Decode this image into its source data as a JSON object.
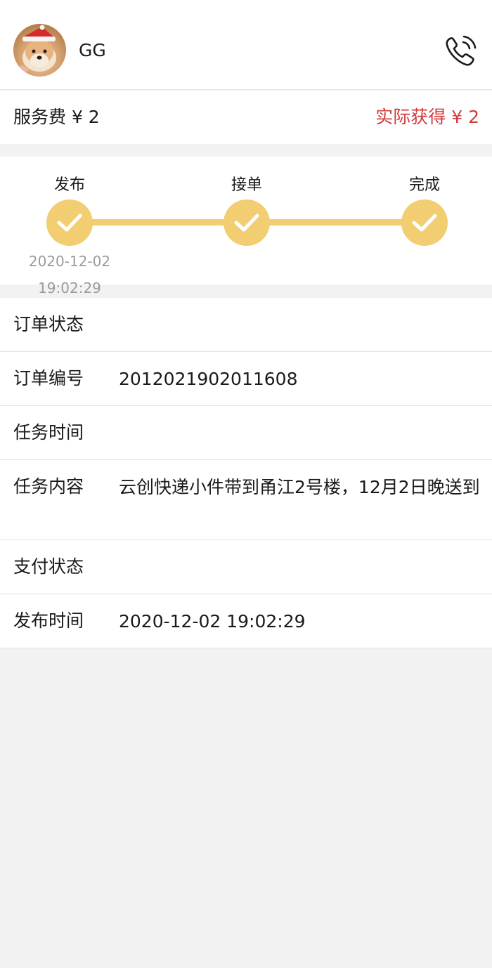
{
  "header": {
    "username": "GG",
    "avatar_icon": "shiba-dog-avatar",
    "call_icon": "phone-icon"
  },
  "fees": {
    "service_fee": "服务费 ¥ 2",
    "actual_earned": "实际获得 ¥ 2",
    "actual_color": "#d23b3b"
  },
  "progress": {
    "accent_color": "#f2cd71",
    "steps": [
      {
        "label": "发布",
        "done": true,
        "date": "2020-12-02",
        "time": "19:02:29"
      },
      {
        "label": "接单",
        "done": true,
        "date": "",
        "time": ""
      },
      {
        "label": "完成",
        "done": true,
        "date": "",
        "time": ""
      }
    ]
  },
  "details": {
    "order_status": {
      "label": "订单状态",
      "value": ""
    },
    "order_number": {
      "label": "订单编号",
      "value": "201202190201160​8"
    },
    "task_time": {
      "label": "任务时间",
      "value": ""
    },
    "task_content": {
      "label": "任务内容",
      "value": "云创快递小件带到甬江2号楼，12月2日晚送到"
    },
    "payment_status": {
      "label": "支付状态",
      "value": ""
    },
    "publish_time": {
      "label": "发布时间",
      "value": "2020-12-02 19:02:29"
    }
  }
}
